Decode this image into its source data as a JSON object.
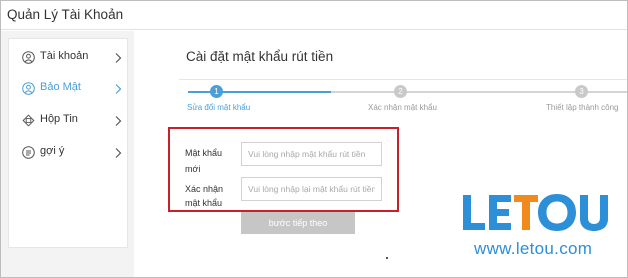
{
  "window": {
    "title": "Quản Lý Tài Khoản"
  },
  "sidebar": {
    "items": [
      {
        "label": "Tài khoản",
        "icon": "user-icon",
        "active": false
      },
      {
        "label": "Bảo Mật",
        "icon": "shield-icon",
        "active": true
      },
      {
        "label": "Hộp Tin",
        "icon": "message-icon",
        "active": false
      },
      {
        "label": "gợi ý",
        "icon": "feedback-icon",
        "active": false
      }
    ]
  },
  "main": {
    "title": "Cài đặt mật khẩu rút tiền",
    "steps": [
      {
        "number": "1",
        "label": "Sửa đổi mật khẩu",
        "state": "active"
      },
      {
        "number": "2",
        "label": "Xác nhận mật khẩu",
        "state": "inactive"
      },
      {
        "number": "3",
        "label": "Thiết lập thành công",
        "state": "inactive"
      }
    ],
    "form": {
      "new_password": {
        "label_line1": "Mật khẩu",
        "label_line2": "mới",
        "placeholder": "Vui lòng nhập mật khẩu rút tiền",
        "value": ""
      },
      "confirm_password": {
        "label_line1": "Xác nhận",
        "label_line2": "mật khẩu",
        "placeholder": "Vui lòng nhập lại mật khẩu rút tiền",
        "value": ""
      }
    },
    "next_button_label": "bước tiếp theo"
  },
  "branding": {
    "logo_text": "LETOU",
    "website": "www.letou.com"
  },
  "colors": {
    "accent_blue": "#4a9fd8",
    "inactive_gray": "#c9c9c9",
    "highlight_red": "#c8202a",
    "logo_blue": "#2c8fd8",
    "logo_orange": "#f08a1c"
  }
}
